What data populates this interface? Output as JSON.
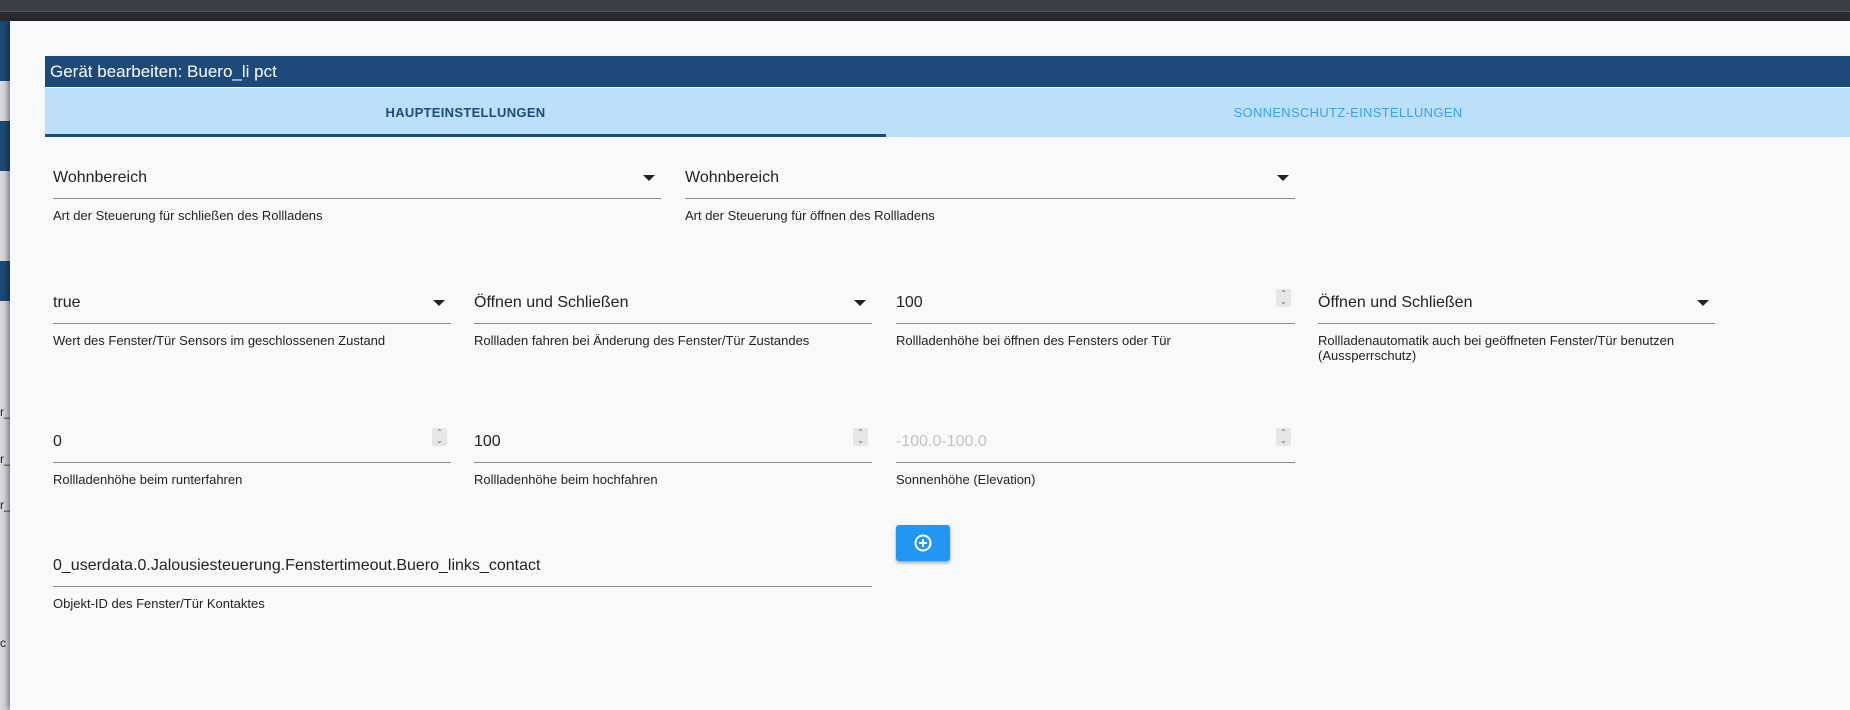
{
  "dialog": {
    "title": "Gerät bearbeiten: Buero_li pct"
  },
  "tabs": [
    {
      "label": "HAUPTEINSTELLUNGEN",
      "active": true
    },
    {
      "label": "SONNENSCHUTZ-EINSTELLUNGEN",
      "active": false
    }
  ],
  "background_fragments": [
    "r_",
    "r_",
    "r_",
    "c"
  ],
  "fields": {
    "close_control": {
      "value": "Wohnbereich",
      "helper": "Art der Steuerung für schließen des Rollladens"
    },
    "open_control": {
      "value": "Wohnbereich",
      "helper": "Art der Steuerung für öffnen des Rollladens"
    },
    "sensor_closed_value": {
      "value": "true",
      "helper": "Wert des Fenster/Tür Sensors im geschlossenen Zustand"
    },
    "shutter_on_change": {
      "value": "Öffnen und Schließen",
      "helper": "Rollladen fahren bei Änderung des Fenster/Tür Zustandes"
    },
    "height_window_open": {
      "value": "100",
      "helper": "Rollladenhöhe bei öffnen des Fensters oder Tür"
    },
    "lockout_protection": {
      "value": "Öffnen und Schließen",
      "helper_line1": "Rollladenautomatik auch bei geöffneten Fenster/Tür benutzen",
      "helper_line2": "(Aussperrschutz)"
    },
    "height_down": {
      "value": "0",
      "helper": "Rollladenhöhe beim runterfahren"
    },
    "height_up": {
      "value": "100",
      "helper": "Rollladenhöhe beim hochfahren"
    },
    "sun_elevation": {
      "placeholder": "-100.0-100.0",
      "helper": "Sonnenhöhe (Elevation)"
    },
    "object_id": {
      "value": "0_userdata.0.Jalousiesteuerung.Fenstertimeout.Buero_links_contact",
      "helper": "Objekt-ID des Fenster/Tür Kontaktes"
    }
  },
  "icons": {
    "dropdown": "chevron-down-icon",
    "spinner": "spinner-arrows-icon",
    "add": "plus-circle-icon"
  },
  "colors": {
    "header": "#1e4a79",
    "tabbar": "#bde0fa",
    "active_tab": "#1e4a79",
    "inactive_tab": "#3a9ee8",
    "button": "#2196f3"
  }
}
